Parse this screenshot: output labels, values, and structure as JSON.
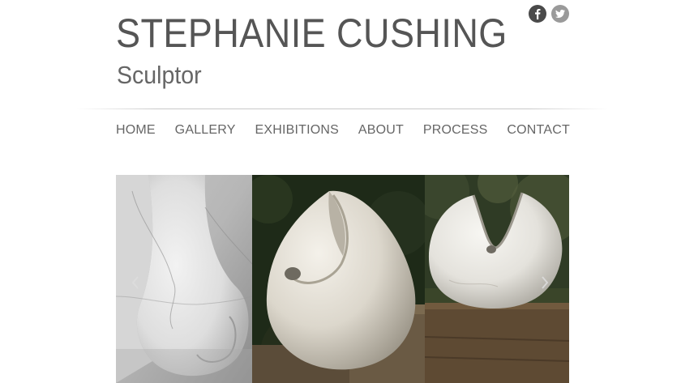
{
  "header": {
    "title": "STEPHANIE CUSHING",
    "subtitle": "Sculptor"
  },
  "social": [
    {
      "name": "facebook-icon",
      "glyph": "f"
    },
    {
      "name": "twitter-icon",
      "glyph": "bird"
    }
  ],
  "nav": {
    "items": [
      {
        "label": "HOME"
      },
      {
        "label": "GALLERY"
      },
      {
        "label": "EXHIBITIONS"
      },
      {
        "label": "ABOUT"
      },
      {
        "label": "PROCESS"
      },
      {
        "label": "CONTACT"
      }
    ]
  },
  "slider": {
    "prev_icon": "chevron-left-icon",
    "next_icon": "chevron-right-icon"
  },
  "colors": {
    "title": "#555555",
    "nav_text": "#666666",
    "divider": "#c9c9c9",
    "facebook_bg": "#4a4a4a",
    "twitter_bg": "#9a9a9a"
  }
}
